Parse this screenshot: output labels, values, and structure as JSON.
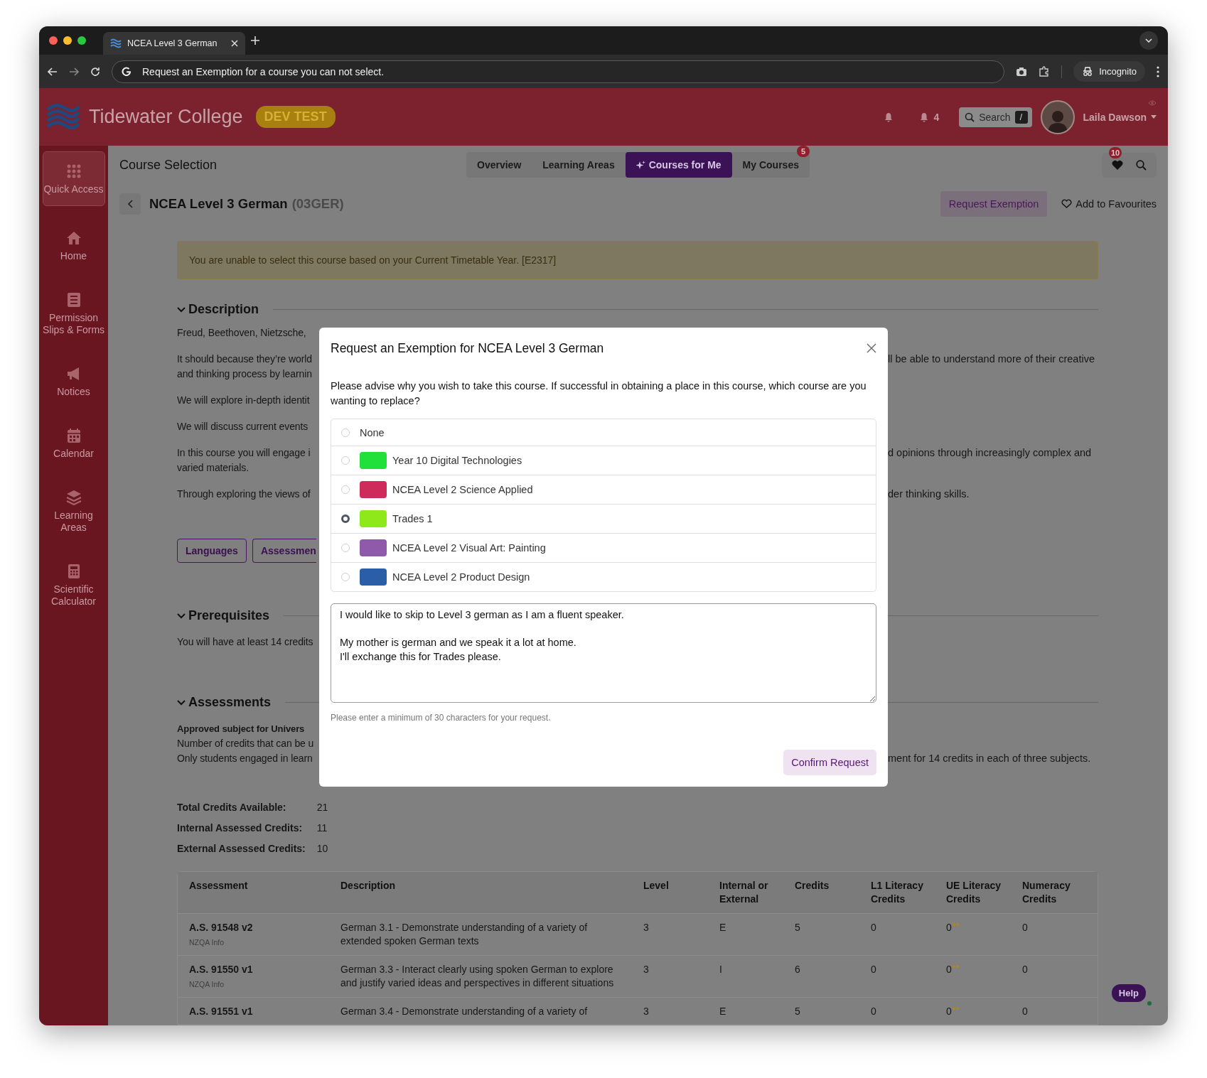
{
  "browser": {
    "tab_title": "NCEA Level 3 German",
    "address": "Request an Exemption for a course you can not select.",
    "profile": "Incognito"
  },
  "header": {
    "school": "Tidewater College",
    "badge": "DEV TEST",
    "notification_count": "4",
    "search_label": "Search",
    "search_shortcut": "/",
    "user": "Laila Dawson"
  },
  "sidebar": {
    "items": [
      {
        "label": "Quick Access",
        "selected": true
      },
      {
        "label": "Home",
        "selected": false
      },
      {
        "label": "Permission Slips & Forms",
        "selected": false
      },
      {
        "label": "Notices",
        "selected": false
      },
      {
        "label": "Calendar",
        "selected": false
      },
      {
        "label": "Learning Areas",
        "selected": false
      },
      {
        "label": "Scientific Calculator",
        "selected": false
      }
    ]
  },
  "page": {
    "title": "Course Selection",
    "tabs": [
      {
        "label": "Overview",
        "selected": false,
        "kind": "plain"
      },
      {
        "label": "Learning Areas",
        "selected": false,
        "kind": "plain"
      },
      {
        "label": "Courses for Me",
        "selected": true,
        "kind": "featured"
      },
      {
        "label": "My Courses",
        "selected": false,
        "kind": "plain",
        "badge": "5"
      }
    ],
    "favourites_count": "10"
  },
  "course": {
    "name": "NCEA Level 3 German",
    "code": "(03GER)",
    "request_button": "Request Exemption",
    "favourite_link": "Add to Favourites"
  },
  "alert": "You are unable to select this course based on your Current Timetable Year. [E2317]",
  "description": {
    "heading": "Description",
    "paragraphs": [
      {
        "lines": [
          {
            "left": "Freud, Beethoven, Nietzsche,"
          }
        ]
      },
      {
        "lines": [
          {
            "left": "It should because they’re world",
            "right": "ll be able to understand more of their creative"
          },
          {
            "left": "and thinking process by learnin"
          }
        ]
      },
      {
        "lines": [
          {
            "left": "We will explore in-depth identit"
          }
        ]
      },
      {
        "lines": [
          {
            "left": "We will discuss current events"
          }
        ]
      },
      {
        "lines": [
          {
            "left": "In this course you will engage i",
            "right": "d opinions through increasingly complex and"
          },
          {
            "left": "varied materials."
          }
        ]
      },
      {
        "lines": [
          {
            "left": "Through exploring the views of",
            "right": "der thinking skills."
          }
        ]
      }
    ]
  },
  "tags": [
    "Languages",
    "Assessmen"
  ],
  "prerequisites": {
    "heading": "Prerequisites",
    "lines": [
      {
        "left": "You will have at least 14 credits"
      }
    ]
  },
  "assessments": {
    "heading": "Assessments",
    "lines": [
      {
        "left": "Approved subject for Univers",
        "bold": true
      },
      {
        "left": "Number of credits that can be u",
        "bold": false
      },
      {
        "left": "Only students engaged in learn",
        "right": "ment for 14 credits in each of three subjects.",
        "bold": false
      }
    ]
  },
  "credits": [
    {
      "label": "Total Credits Available:",
      "value": "21"
    },
    {
      "label": "Internal Assessed Credits:",
      "value": "11"
    },
    {
      "label": "External Assessed Credits:",
      "value": "10"
    }
  ],
  "table": {
    "columns": [
      "Assessment",
      "Description",
      "Level",
      "Internal or External",
      "Credits",
      "L1 Literacy Credits",
      "UE Literacy Credits",
      "Numeracy Credits"
    ],
    "rows": [
      {
        "assessment": "A.S. 91548 v2",
        "info": "NZQA Info",
        "description": "German 3.1 - Demonstrate understanding of a variety of extended spoken German texts",
        "level": "3",
        "type": "E",
        "credits": "5",
        "l1": "0",
        "ue": "0",
        "ue_flagged": true,
        "numeracy": "0"
      },
      {
        "assessment": "A.S. 91550 v1",
        "info": "NZQA Info",
        "description": "German 3.3 - Interact clearly using spoken German to explore and justify varied ideas and perspectives in different situations",
        "level": "3",
        "type": "I",
        "credits": "6",
        "l1": "0",
        "ue": "0",
        "ue_flagged": true,
        "numeracy": "0"
      },
      {
        "assessment": "A.S. 91551 v1",
        "description": "German 3.4 - Demonstrate understanding of a variety of",
        "level": "3",
        "type": "E",
        "credits": "5",
        "l1": "0",
        "ue": "0",
        "ue_flagged": true,
        "numeracy": "0"
      }
    ]
  },
  "help": "Help",
  "modal": {
    "title": "Request an Exemption for NCEA Level 3 German",
    "prompt": "Please advise why you wish to take this course. If successful in obtaining a place in this course, which course are you wanting to replace?",
    "options": [
      {
        "label": "None",
        "selected": false
      },
      {
        "label": "Year 10 Digital Technologies",
        "selected": false,
        "color": "#22e03a"
      },
      {
        "label": "NCEA Level 2 Science Applied",
        "selected": false,
        "color": "#cf2a5c"
      },
      {
        "label": "Trades 1",
        "selected": true,
        "color": "#8ee81a"
      },
      {
        "label": "NCEA Level 2 Visual Art: Painting",
        "selected": false,
        "color": "#8f5aaa"
      },
      {
        "label": "NCEA Level 2 Product Design",
        "selected": false,
        "color": "#2a5fa8"
      }
    ],
    "reason": "I would like to skip to Level 3 german as I am a fluent speaker.\n\nMy mother is german and we speak it a lot at home.\nI'll exchange this for Trades please. ",
    "hint": "Please enter a minimum of 30 characters for your request.",
    "confirm": "Confirm Request"
  }
}
